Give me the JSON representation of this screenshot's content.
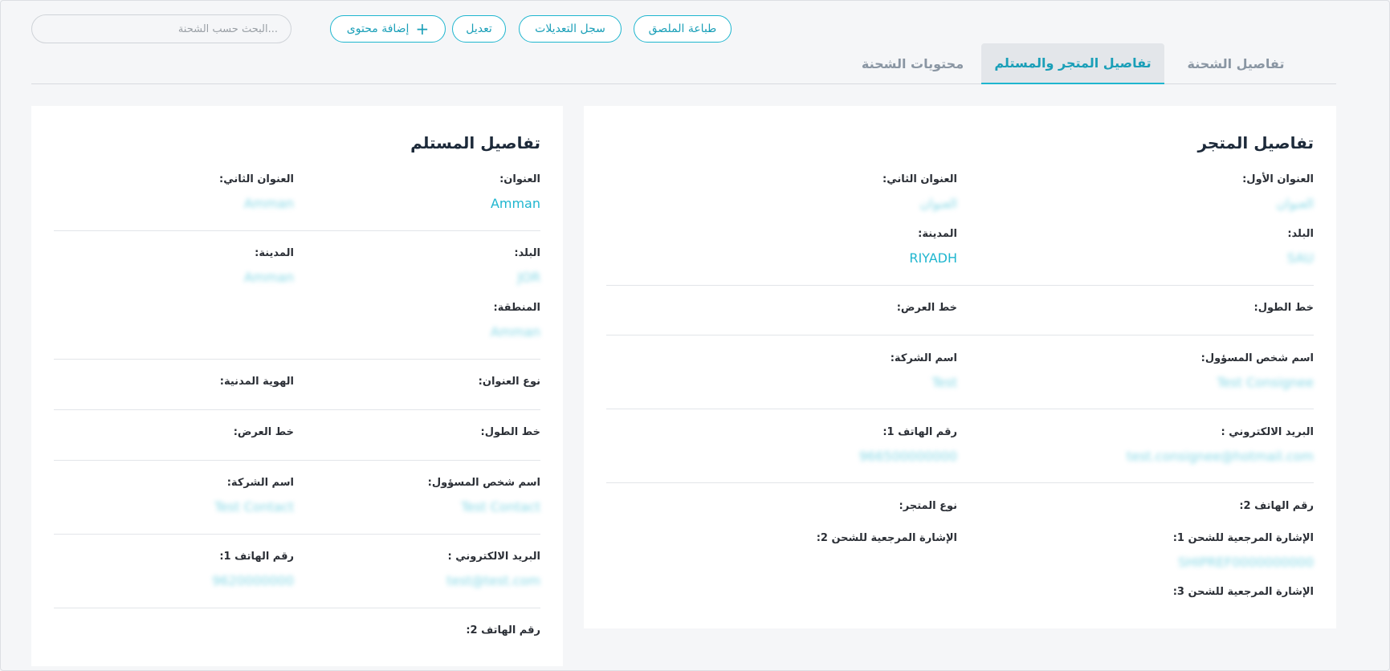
{
  "toolbar": {
    "print_label": "طباعة الملصق",
    "history_label": "سجل التعديلات",
    "edit_label": "تعديل",
    "add_content_label": "إضافة محتوى",
    "search_placeholder": "...البحث حسب الشحنة"
  },
  "tabs": [
    {
      "label": "تفاصيل الشحنة"
    },
    {
      "label": "تفاصيل المتجر والمستلم"
    },
    {
      "label": "محتويات الشحنة"
    }
  ],
  "store": {
    "title": "تفاصيل المتجر",
    "address1_label": "العنوان الأول:",
    "address1_value": "العنوان",
    "address2_label": "العنوان الثاني:",
    "address2_value": "العنوان",
    "country_label": "البلد:",
    "country_value": "SAU",
    "city_label": "المدينة:",
    "city_value": "RIYADH",
    "longitude_label": "خط الطول:",
    "latitude_label": "خط العرض:",
    "contact_label": "اسم شخص المسؤول:",
    "contact_value": "Test Consignee",
    "company_label": "اسم الشركة:",
    "company_value": "Test",
    "email_label": "البريد الالكتروني :",
    "email_value": "test.consignee@hotmail.com",
    "phone1_label": "رقم الهاتف 1:",
    "phone1_value": "966500000000",
    "phone2_label": "رقم الهاتف 2:",
    "store_type_label": "نوع المتجر:",
    "ref1_label": "الإشارة المرجعية للشحن 1:",
    "ref1_value": "SHIPREF0000000000",
    "ref2_label": "الإشارة المرجعية للشحن 2:",
    "ref3_label": "الإشارة المرجعية للشحن 3:"
  },
  "receiver": {
    "title": "تفاصيل المستلم",
    "address_label": "العنوان:",
    "address_value": "Amman",
    "address2_label": "العنوان الثاني:",
    "address2_value": "Amman",
    "country_label": "البلد:",
    "country_value": "JOR",
    "city_label": "المدينة:",
    "city_value": "Amman",
    "region_label": "المنطقة:",
    "region_value": "Amman",
    "address_type_label": "نوع العنوان:",
    "civil_id_label": "الهوية المدنية:",
    "longitude_label": "خط الطول:",
    "latitude_label": "خط العرض:",
    "contact_label": "اسم شخص المسؤول:",
    "contact_value": "Test Contact",
    "company_label": "اسم الشركة:",
    "company_value": "Test Contact",
    "email_label": "البريد الالكتروني :",
    "email_value": "test@test.com",
    "phone1_label": "رقم الهاتف 1:",
    "phone1_value": "9620000000",
    "phone2_label": "رقم الهاتف 2:"
  },
  "colors": {
    "accent": "#1fb6cf",
    "background": "#f5f6f8",
    "card": "#ffffff"
  }
}
